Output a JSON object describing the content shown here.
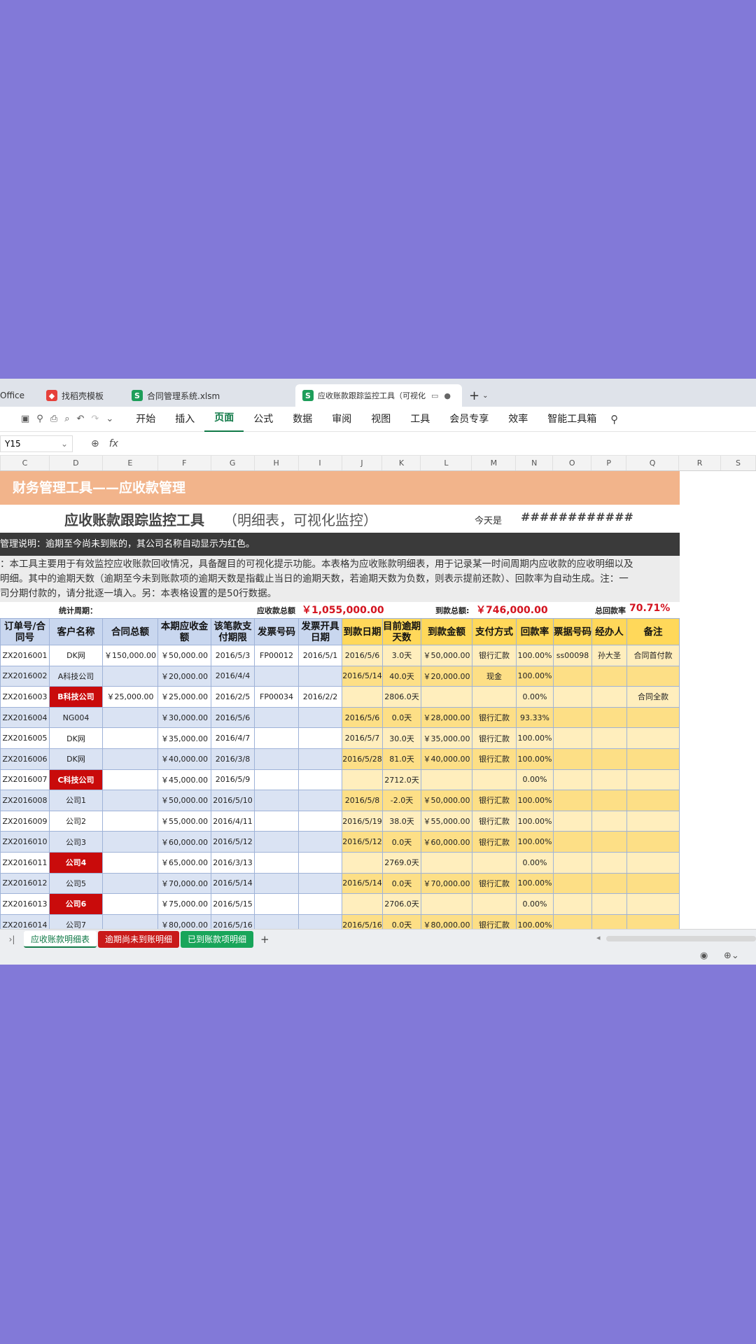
{
  "tabs": [
    {
      "label": "Office",
      "icon": "none"
    },
    {
      "label": "找稻壳模板",
      "icon": "docer-icon"
    },
    {
      "label": "合同管理系统.xlsm",
      "icon": "spreadsheet-icon"
    },
    {
      "label": "应收账款跟踪监控工具（可视化",
      "icon": "spreadsheet-icon"
    }
  ],
  "toolbar": {
    "menu": [
      "开始",
      "插入",
      "页面",
      "公式",
      "数据",
      "审阅",
      "视图",
      "工具",
      "会员专享",
      "效率",
      "智能工具箱"
    ],
    "active": "页面"
  },
  "namebox": "Y15",
  "fx": "fx",
  "columns": [
    "C",
    "D",
    "E",
    "F",
    "G",
    "H",
    "I",
    "J",
    "K",
    "L",
    "M",
    "N",
    "O",
    "P",
    "Q",
    "R",
    "S"
  ],
  "sheet": {
    "banner": "财务管理工具——应收款管理",
    "title_main": "应收账款跟踪监控工具",
    "title_sub": "（明细表，可视化监控）",
    "today_label": "今天是",
    "today_value": "############",
    "note": "管理说明：逾期至今尚未到账的，其公司名称自动显示为红色。",
    "desc_lines": [
      "：本工具主要用于有效监控应收账款回收情况，具备醒目的可视化提示功能。本表格为应收账款明细表，用于记录某一时间周期内应收款的应收明细以及",
      "明细。其中的逾期天数（逾期至今未到账款项的逾期天数是指截止当日的逾期天数，若逾期天数为负数，则表示提前还款）、回款率为自动生成。注：一",
      "司分期付款的，请分批逐一填入。另：本表格设置的是50行数据。"
    ],
    "stats": {
      "period_label": "统计周期：",
      "receivable_label": "应收款总额",
      "receivable_value": "￥1,055,000.00",
      "received_label": "到款总额:",
      "received_value": "￥746,000.00",
      "rate_label": "总回款率",
      "rate_value": "70.71%"
    },
    "headers": [
      "订单号/合同号",
      "客户名称",
      "合同总额",
      "本期应收金额",
      "该笔款支付期限",
      "发票号码",
      "发票开具日期",
      "到款日期",
      "目前逾期天数",
      "到款金额",
      "支付方式",
      "回款率",
      "票据号码",
      "经办人",
      "备注"
    ],
    "rows": [
      [
        "ZX2016001",
        "DK网",
        "￥150,000.00",
        "￥50,000.00",
        "2016/5/3",
        "FP00012",
        "2016/5/1",
        "2016/5/6",
        "3.0天",
        "￥50,000.00",
        "银行汇款",
        "100.00%",
        "ss00098",
        "孙大圣",
        "合同首付款"
      ],
      [
        "ZX2016002",
        "A科技公司",
        "",
        "￥20,000.00",
        "2016/4/4",
        "",
        "",
        "2016/5/14",
        "40.0天",
        "￥20,000.00",
        "现金",
        "100.00%",
        "",
        "",
        ""
      ],
      [
        "ZX2016003",
        "B科技公司",
        "￥25,000.00",
        "￥25,000.00",
        "2016/2/5",
        "FP00034",
        "2016/2/2",
        "",
        "2806.0天",
        "",
        "",
        "0.00%",
        "",
        "",
        "合同全款"
      ],
      [
        "ZX2016004",
        "NG004",
        "",
        "￥30,000.00",
        "2016/5/6",
        "",
        "",
        "2016/5/6",
        "0.0天",
        "￥28,000.00",
        "银行汇款",
        "93.33%",
        "",
        "",
        ""
      ],
      [
        "ZX2016005",
        "DK网",
        "",
        "￥35,000.00",
        "2016/4/7",
        "",
        "",
        "2016/5/7",
        "30.0天",
        "￥35,000.00",
        "银行汇款",
        "100.00%",
        "",
        "",
        ""
      ],
      [
        "ZX2016006",
        "DK网",
        "",
        "￥40,000.00",
        "2016/3/8",
        "",
        "",
        "2016/5/28",
        "81.0天",
        "￥40,000.00",
        "银行汇款",
        "100.00%",
        "",
        "",
        ""
      ],
      [
        "ZX2016007",
        "C科技公司",
        "",
        "￥45,000.00",
        "2016/5/9",
        "",
        "",
        "",
        "2712.0天",
        "",
        "",
        "0.00%",
        "",
        "",
        ""
      ],
      [
        "ZX2016008",
        "公司1",
        "",
        "￥50,000.00",
        "2016/5/10",
        "",
        "",
        "2016/5/8",
        "-2.0天",
        "￥50,000.00",
        "银行汇款",
        "100.00%",
        "",
        "",
        ""
      ],
      [
        "ZX2016009",
        "公司2",
        "",
        "￥55,000.00",
        "2016/4/11",
        "",
        "",
        "2016/5/19",
        "38.0天",
        "￥55,000.00",
        "银行汇款",
        "100.00%",
        "",
        "",
        ""
      ],
      [
        "ZX2016010",
        "公司3",
        "",
        "￥60,000.00",
        "2016/5/12",
        "",
        "",
        "2016/5/12",
        "0.0天",
        "￥60,000.00",
        "银行汇款",
        "100.00%",
        "",
        "",
        ""
      ],
      [
        "ZX2016011",
        "公司4",
        "",
        "￥65,000.00",
        "2016/3/13",
        "",
        "",
        "",
        "2769.0天",
        "",
        "",
        "0.00%",
        "",
        "",
        ""
      ],
      [
        "ZX2016012",
        "公司5",
        "",
        "￥70,000.00",
        "2016/5/14",
        "",
        "",
        "2016/5/14",
        "0.0天",
        "￥70,000.00",
        "银行汇款",
        "100.00%",
        "",
        "",
        ""
      ],
      [
        "ZX2016013",
        "公司6",
        "",
        "￥75,000.00",
        "2016/5/15",
        "",
        "",
        "",
        "2706.0天",
        "",
        "",
        "0.00%",
        "",
        "",
        ""
      ],
      [
        "ZX2016014",
        "公司7",
        "",
        "￥80,000.00",
        "2016/5/16",
        "",
        "",
        "2016/5/16",
        "0.0天",
        "￥80,000.00",
        "银行汇款",
        "100.00%",
        "",
        "",
        ""
      ]
    ],
    "red_rows": [
      2,
      6,
      10,
      12
    ]
  },
  "sheet_tabs": [
    {
      "label": "应收账款明细表",
      "style": "active"
    },
    {
      "label": "逾期尚未到账明细",
      "style": "red"
    },
    {
      "label": "已到账款项明细",
      "style": "green"
    }
  ]
}
